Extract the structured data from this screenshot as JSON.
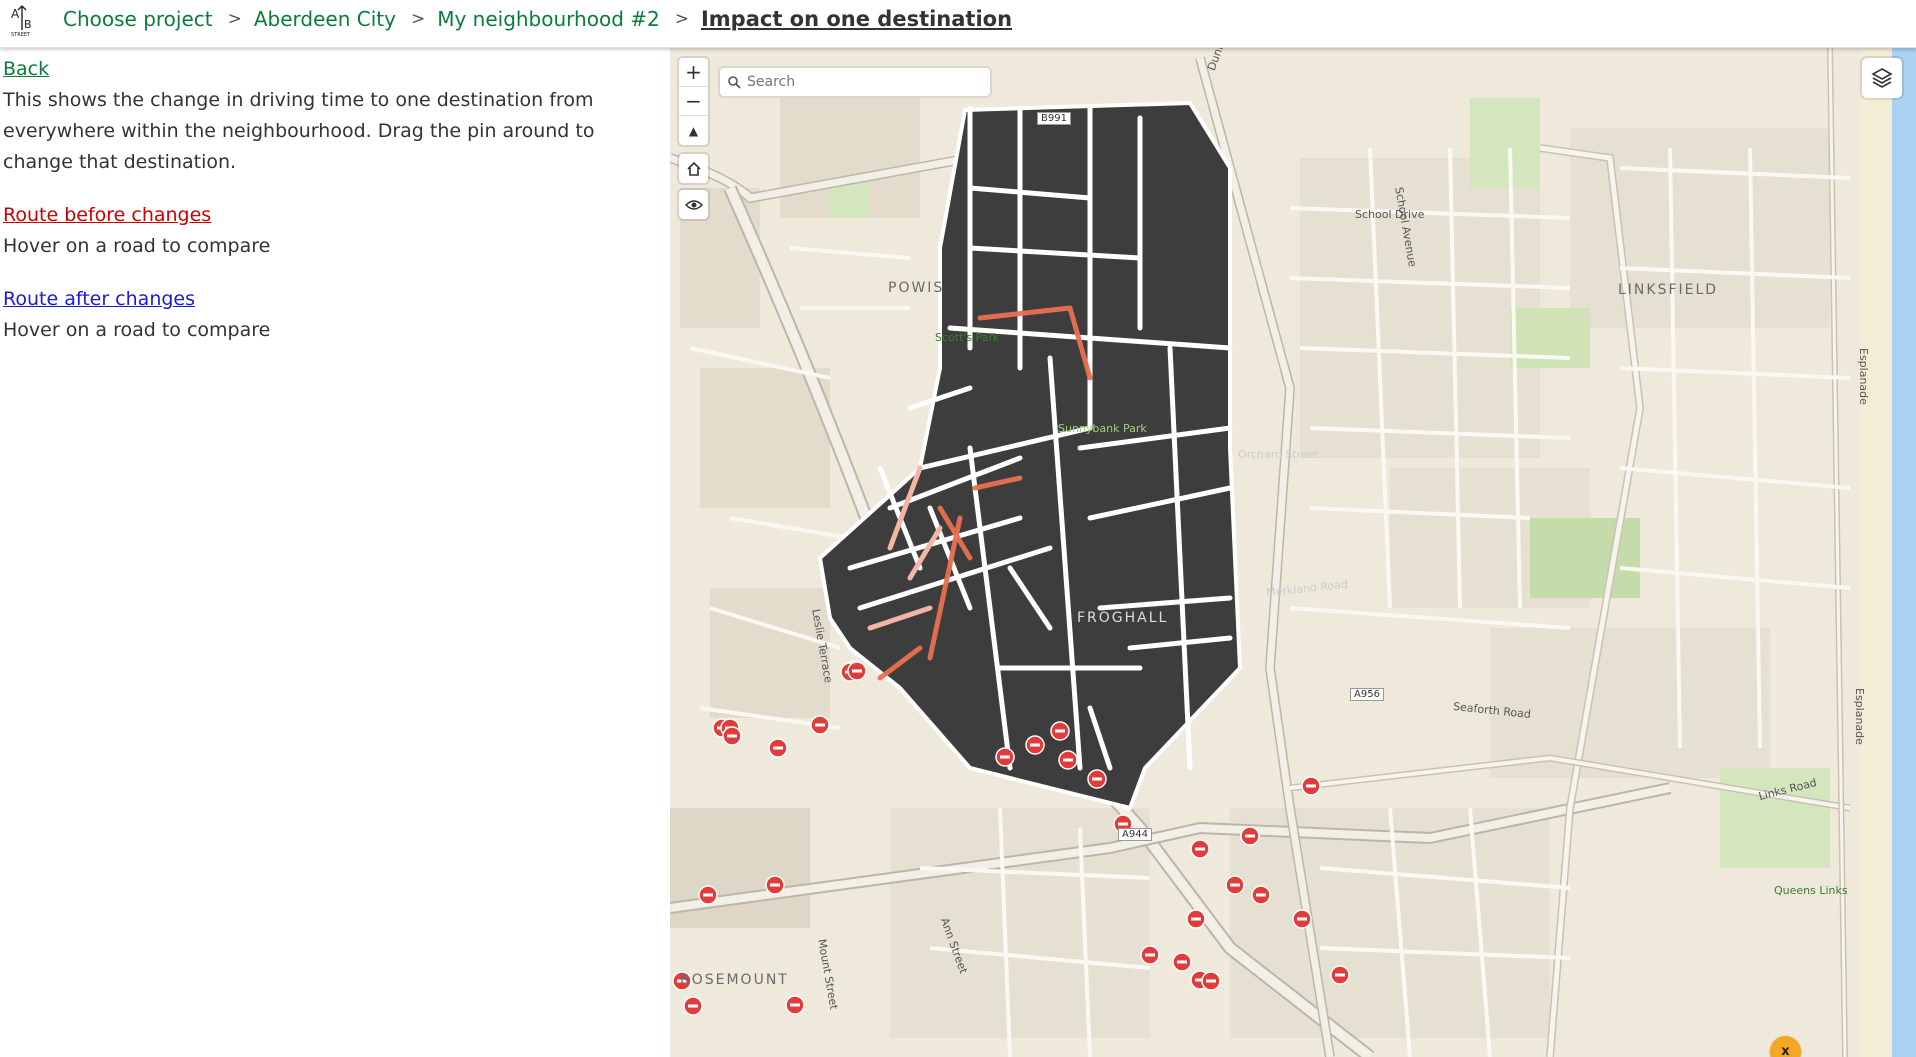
{
  "header": {
    "logo_label": "A/B STREET",
    "breadcrumbs": [
      {
        "label": "Choose project"
      },
      {
        "label": "Aberdeen City"
      },
      {
        "label": "My neighbourhood #2"
      }
    ],
    "separator": ">",
    "current": "Impact on one destination"
  },
  "sidebar": {
    "back_label": "Back",
    "intro": "This shows the change in driving time to one destination from everywhere within the neighbourhood. Drag the pin around to change that destination.",
    "route_before": {
      "label": "Route before changes",
      "hint": "Hover on a road to compare",
      "color": "#cc0000"
    },
    "route_after": {
      "label": "Route after changes",
      "hint": "Hover on a road to compare",
      "color": "#1a1ad6"
    }
  },
  "map": {
    "controls": {
      "zoom_in": "+",
      "zoom_out": "−",
      "compass": "▲",
      "home_icon": "home-icon",
      "eye_icon": "eye-icon"
    },
    "search": {
      "placeholder": "Search"
    },
    "layers_icon": "layers-icon",
    "destination_pin": "x",
    "labels": {
      "powis": "POWIS",
      "linksfield": "LINKSFIELD",
      "frochall": "FROGHALL",
      "rosemount": "ROSEMOUNT",
      "scotts_park": "Scott's Park",
      "sunnybank_park": "Sunnybank Park",
      "school_drive": "School Drive",
      "school_avenue": "School Avenue",
      "orchard_street": "Orchard Street",
      "merkland_road": "Merkland Road",
      "seaforth_road": "Seaforth Road",
      "links_road": "Links Road",
      "queens_links": "Queens Links",
      "esplanade_1": "Esplanade",
      "esplanade_2": "Esplanade",
      "leslie_terrace": "Leslie Terrace",
      "mount_street": "Mount Street",
      "ann_street": "Ann Street",
      "dunbar_street": "Dunbar Street",
      "b991": "B991",
      "a956": "A956",
      "a944": "A944"
    },
    "colors": {
      "neighbourhood_fill": "#3d3d3d",
      "filter_red": "#e23b3b",
      "route_worse": "#e8704f",
      "sea": "#a9d3f0"
    }
  }
}
